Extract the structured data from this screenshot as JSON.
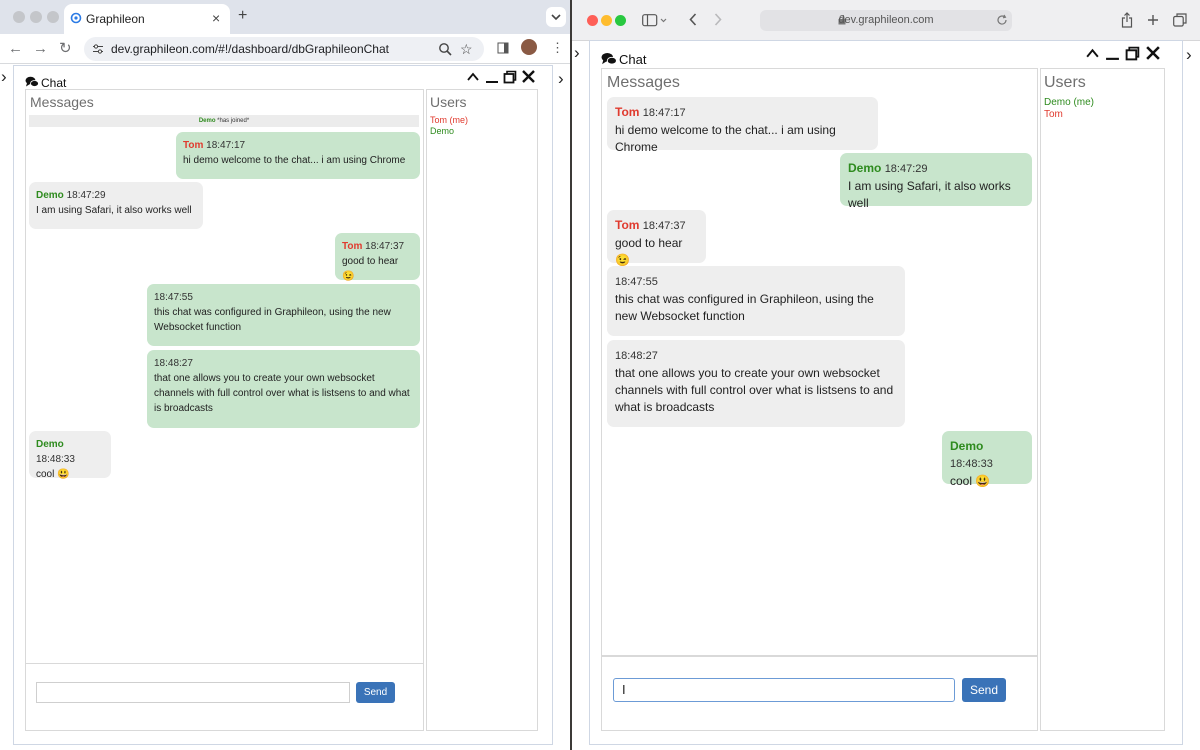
{
  "chrome": {
    "tab_title": "Graphileon",
    "tab_close": "×",
    "new_tab": "+",
    "url": "dev.graphileon.com/#!/dashboard/dbGraphileonChat"
  },
  "safari": {
    "url": "dev.graphileon.com"
  },
  "chat": {
    "panel_title": "Chat",
    "messages_title": "Messages",
    "users_title": "Users",
    "send_label": "Send",
    "input_value_right": "I"
  },
  "left": {
    "join_author": "Demo",
    "join_text": "*has joined*",
    "users": [
      "Tom (me)",
      "Demo"
    ],
    "messages": [
      {
        "author": "Tom",
        "time": "18:47:17",
        "text": "hi demo welcome to the chat... i am using Chrome"
      },
      {
        "author": "Demo",
        "time": "18:47:29",
        "text": "I am using Safari, it also works well"
      },
      {
        "author": "Tom",
        "time": "18:47:37",
        "text": "good to hear 😉"
      },
      {
        "author": "",
        "time": "18:47:55",
        "text": "this chat was configured in Graphileon, using the new Websocket function"
      },
      {
        "author": "",
        "time": "18:48:27",
        "text": "that one allows you to create your own websocket channels with full control over what is listsens to and what is broadcasts"
      },
      {
        "author": "Demo",
        "time": "18:48:33",
        "text": "cool 😃"
      }
    ]
  },
  "right": {
    "users": [
      "Demo (me)",
      "Tom"
    ],
    "messages": [
      {
        "author": "Tom",
        "time": "18:47:17",
        "text": "hi demo welcome to the chat... i am using Chrome"
      },
      {
        "author": "Demo",
        "time": "18:47:29",
        "text": "I am using Safari, it also works well"
      },
      {
        "author": "Tom",
        "time": "18:47:37",
        "text": "good to hear 😉"
      },
      {
        "author": "",
        "time": "18:47:55",
        "text": "this chat was configured in Graphileon, using the new Websocket function"
      },
      {
        "author": "",
        "time": "18:48:27",
        "text": "that one allows you to create your own websocket channels with full control over what is listsens to and what is broadcasts"
      },
      {
        "author": "Demo",
        "time": "18:48:33",
        "text": "cool 😃"
      }
    ]
  },
  "colors": {
    "tom": "#e03a2e",
    "demo": "#2e8b1e",
    "own_bubble": "#c8e5cc",
    "other_bubble": "#eeeeee",
    "send_button": "#3a73b8"
  }
}
